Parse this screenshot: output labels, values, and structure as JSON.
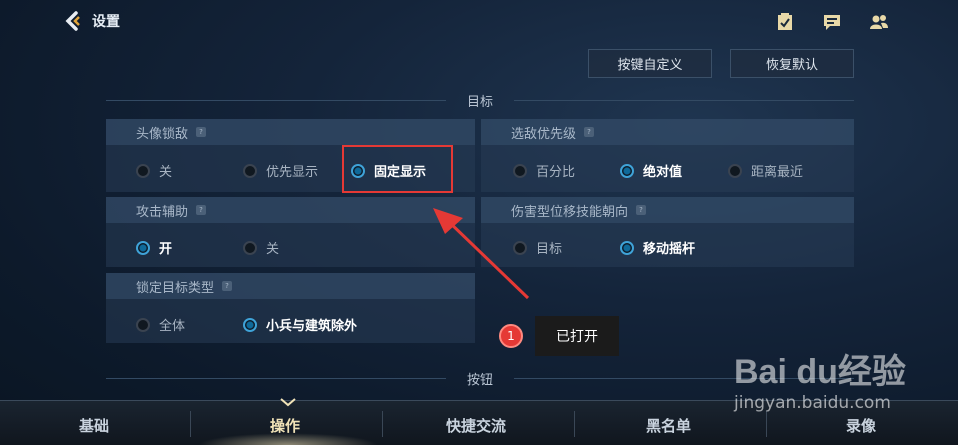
{
  "header": {
    "title": "设置",
    "icons": [
      "task-icon",
      "chat-icon",
      "friends-icon"
    ]
  },
  "top_buttons": {
    "custom_keys": "按键自定义",
    "restore_default": "恢复默认"
  },
  "sections": {
    "target": "目标",
    "buttons": "按钮"
  },
  "panels": {
    "avatar_lock": {
      "title": "头像锁敌",
      "options": [
        "关",
        "优先显示",
        "固定显示"
      ],
      "selected": "固定显示"
    },
    "enemy_priority": {
      "title": "选敌优先级",
      "options": [
        "百分比",
        "绝对值",
        "距离最近"
      ],
      "selected": "绝对值"
    },
    "attack_assist": {
      "title": "攻击辅助",
      "options": [
        "开",
        "关"
      ],
      "selected": "开"
    },
    "skill_direction": {
      "title": "伤害型位移技能朝向",
      "options": [
        "目标",
        "移动摇杆"
      ],
      "selected": "移动摇杆"
    },
    "lock_target_type": {
      "title": "锁定目标类型",
      "options": [
        "全体",
        "小兵与建筑除外"
      ],
      "selected": "小兵与建筑除外"
    }
  },
  "annotation": {
    "badge": "1",
    "text": "已打开",
    "color": "#e53935"
  },
  "tabs": [
    "基础",
    "操作",
    "快捷交流",
    "黑名单",
    "录像"
  ],
  "active_tab": "操作",
  "watermark": {
    "brand": "Bai du经验",
    "url": "jingyan.baidu.com"
  }
}
